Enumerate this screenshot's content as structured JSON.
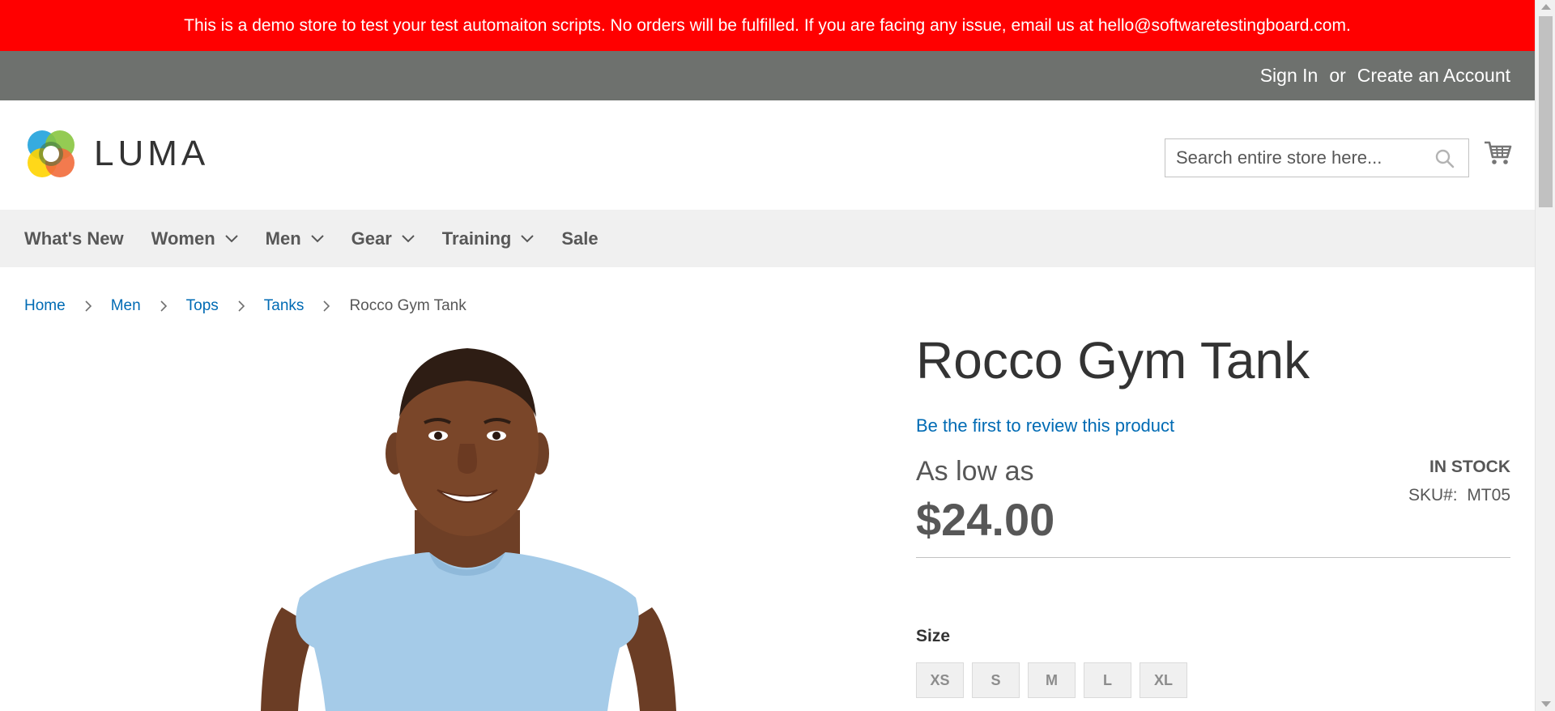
{
  "demo_notice": "This is a demo store to test your test automaiton scripts. No orders will be fulfilled. If you are facing any issue, email us at hello@softwaretestingboard.com.",
  "header_links": {
    "sign_in": "Sign In",
    "or": "or",
    "create_account": "Create an Account"
  },
  "logo": {
    "text": "LUMA",
    "icon": "luma-logo-icon"
  },
  "search": {
    "placeholder": "Search entire store here...",
    "icon": "search-icon"
  },
  "cart": {
    "icon": "shopping-cart-icon"
  },
  "nav": {
    "items": [
      {
        "label": "What's New",
        "has_dropdown": false
      },
      {
        "label": "Women",
        "has_dropdown": true
      },
      {
        "label": "Men",
        "has_dropdown": true
      },
      {
        "label": "Gear",
        "has_dropdown": true
      },
      {
        "label": "Training",
        "has_dropdown": true
      },
      {
        "label": "Sale",
        "has_dropdown": false
      }
    ]
  },
  "breadcrumbs": {
    "items": [
      "Home",
      "Men",
      "Tops",
      "Tanks"
    ],
    "current": "Rocco Gym Tank"
  },
  "product": {
    "title": "Rocco Gym Tank",
    "review_link": "Be the first to review this product",
    "price_label": "As low as",
    "price": "$24.00",
    "stock": "IN STOCK",
    "sku_label": "SKU#:",
    "sku": "MT05",
    "size_label": "Size",
    "sizes": [
      "XS",
      "S",
      "M",
      "L",
      "XL"
    ]
  },
  "colors": {
    "banner": "#ff0000",
    "panel_header": "#6e716e",
    "link": "#006bb4",
    "nav_bg": "#f0f0f0",
    "shirt": "#a5cbe8"
  }
}
